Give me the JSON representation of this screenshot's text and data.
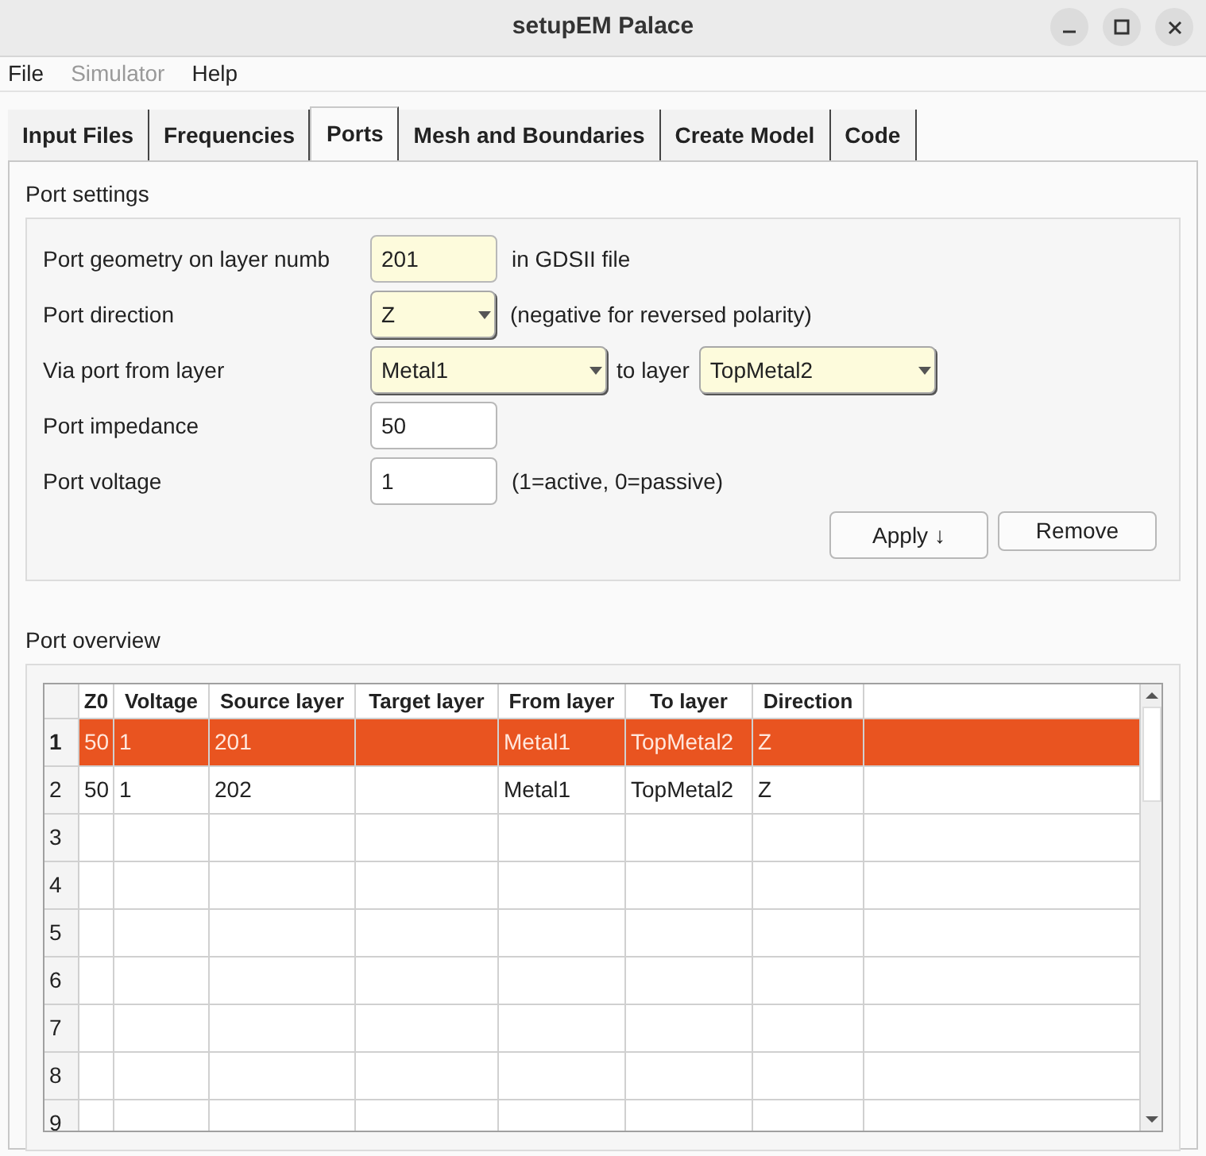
{
  "window": {
    "title": "setupEM Palace"
  },
  "menu": [
    {
      "label": "File",
      "disabled": false
    },
    {
      "label": "Simulator",
      "disabled": true
    },
    {
      "label": "Help",
      "disabled": false
    }
  ],
  "tabs": [
    {
      "label": "Input Files",
      "selected": false
    },
    {
      "label": "Frequencies",
      "selected": false
    },
    {
      "label": "Ports",
      "selected": true
    },
    {
      "label": "Mesh and Boundaries",
      "selected": false
    },
    {
      "label": "Create Model",
      "selected": false
    },
    {
      "label": "Code",
      "selected": false
    }
  ],
  "port_settings": {
    "title": "Port settings",
    "rows": [
      {
        "label": "Port geometry on layer numb",
        "fields": [
          {
            "kind": "input",
            "value": "201",
            "highlighted": true
          }
        ],
        "note": "in GDSII file"
      },
      {
        "label": "Port direction",
        "fields": [
          {
            "kind": "combo",
            "value": "Z"
          }
        ],
        "note": "(negative for reversed polarity)"
      },
      {
        "label": "Via port from layer",
        "fields": [
          {
            "kind": "combo",
            "value": "Metal1"
          },
          {
            "kind": "text",
            "value": "to layer"
          },
          {
            "kind": "combo",
            "value": "TopMetal2"
          }
        ]
      },
      {
        "label": "Port impedance",
        "fields": [
          {
            "kind": "input",
            "value": "50",
            "highlighted": false
          }
        ]
      },
      {
        "label": "Port voltage",
        "fields": [
          {
            "kind": "input",
            "value": "1",
            "highlighted": false
          }
        ],
        "note": "(1=active, 0=passive)"
      }
    ],
    "buttons": [
      "Apply ↓",
      "Remove"
    ]
  },
  "port_overview": {
    "title": "Port overview",
    "columns": [
      "Z0",
      "Voltage",
      "Source layer",
      "Target layer",
      "From layer",
      "To layer",
      "Direction"
    ],
    "rows": [
      {
        "header": "1",
        "selected": true,
        "cells": [
          "50",
          "1",
          "201",
          "",
          "Metal1",
          "TopMetal2",
          "Z"
        ]
      },
      {
        "header": "2",
        "selected": false,
        "cells": [
          "50",
          "1",
          "202",
          "",
          "Metal1",
          "TopMetal2",
          "Z"
        ]
      },
      {
        "header": "3",
        "selected": false
      },
      {
        "header": "4",
        "selected": false
      },
      {
        "header": "5",
        "selected": false
      },
      {
        "header": "6",
        "selected": false
      },
      {
        "header": "7",
        "selected": false
      },
      {
        "header": "8",
        "selected": false
      },
      {
        "header": "9",
        "selected": false
      }
    ]
  }
}
